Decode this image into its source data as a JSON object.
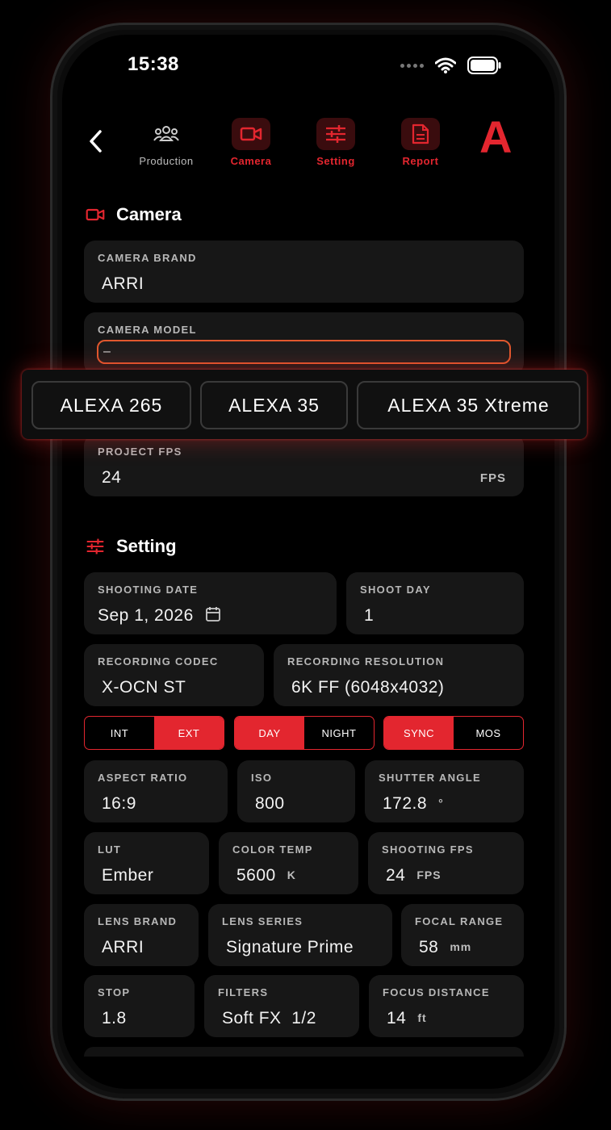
{
  "status": {
    "time": "15:38"
  },
  "nav": {
    "items": [
      {
        "label": "Production",
        "icon": "people-icon",
        "active": false
      },
      {
        "label": "Camera",
        "icon": "video-camera-icon",
        "active": true
      },
      {
        "label": "Setting",
        "icon": "sliders-icon",
        "active": true
      },
      {
        "label": "Report",
        "icon": "document-icon",
        "active": true
      }
    ],
    "brand_letter": "A"
  },
  "camera": {
    "title": "Camera",
    "brand": {
      "label": "CAMERA BRAND",
      "value": "ARRI"
    },
    "model": {
      "label": "CAMERA MODEL",
      "value": "–"
    },
    "suggestions": [
      "ALEXA 265",
      "ALEXA 35",
      "ALEXA 35 Xtreme"
    ],
    "project_fps": {
      "label": "PROJECT FPS",
      "value": "24",
      "unit": "FPS"
    }
  },
  "setting": {
    "title": "Setting",
    "shooting_date": {
      "label": "SHOOTING DATE",
      "value": "Sep 1, 2026"
    },
    "shoot_day": {
      "label": "SHOOT DAY",
      "value": "1"
    },
    "recording_codec": {
      "label": "RECORDING CODEC",
      "value": "X-OCN ST"
    },
    "recording_resolution": {
      "label": "RECORDING RESOLUTION",
      "value": "6K FF (6048x4032)"
    },
    "toggles": [
      {
        "options": [
          "INT",
          "EXT"
        ],
        "selected": "EXT"
      },
      {
        "options": [
          "DAY",
          "NIGHT"
        ],
        "selected": "DAY"
      },
      {
        "options": [
          "SYNC",
          "MOS"
        ],
        "selected": "SYNC"
      }
    ],
    "aspect_ratio": {
      "label": "ASPECT RATIO",
      "value": "16:9"
    },
    "iso": {
      "label": "ISO",
      "value": "800"
    },
    "shutter_angle": {
      "label": "SHUTTER ANGLE",
      "value": "172.8",
      "unit": "°"
    },
    "lut": {
      "label": "LUT",
      "value": "Ember"
    },
    "color_temp": {
      "label": "COLOR TEMP",
      "value": "5600",
      "unit": "K"
    },
    "shooting_fps": {
      "label": "SHOOTING FPS",
      "value": "24",
      "unit": "FPS"
    },
    "lens_brand": {
      "label": "LENS BRAND",
      "value": "ARRI"
    },
    "lens_series": {
      "label": "LENS SERIES",
      "value": "Signature Prime"
    },
    "focal_range": {
      "label": "FOCAL RANGE",
      "value": "58",
      "unit": "mm"
    },
    "stop": {
      "label": "STOP",
      "value": "1.8"
    },
    "filters": {
      "label": "FILTERS",
      "value": "Soft FX  1/2"
    },
    "focus_distance": {
      "label": "FOCUS DISTANCE",
      "value": "14",
      "unit": "ft"
    }
  },
  "colors": {
    "accent": "#e3262f",
    "card": "#171717",
    "focus_border": "#e0582e"
  }
}
